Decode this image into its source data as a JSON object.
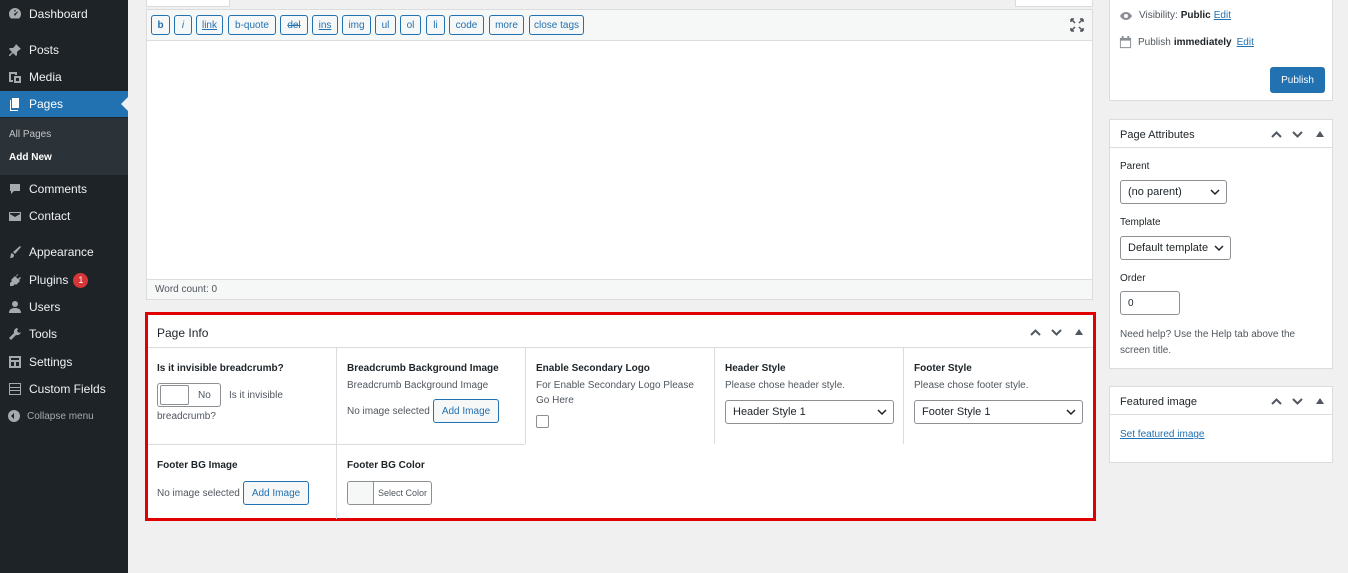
{
  "sidebar": {
    "items": [
      {
        "label": "Dashboard",
        "icon": "dashboard-icon"
      },
      {
        "label": "Posts",
        "icon": "pin-icon"
      },
      {
        "label": "Media",
        "icon": "media-icon"
      },
      {
        "label": "Pages",
        "icon": "pages-icon"
      },
      {
        "label": "Comments",
        "icon": "comment-icon"
      },
      {
        "label": "Contact",
        "icon": "mail-icon"
      },
      {
        "label": "Appearance",
        "icon": "brush-icon"
      },
      {
        "label": "Plugins",
        "icon": "plug-icon"
      },
      {
        "label": "Users",
        "icon": "user-icon"
      },
      {
        "label": "Tools",
        "icon": "wrench-icon"
      },
      {
        "label": "Settings",
        "icon": "settings-icon"
      },
      {
        "label": "Custom Fields",
        "icon": "grid-icon"
      }
    ],
    "submenu": [
      "All Pages",
      "Add New"
    ],
    "plugins_badge": "1",
    "collapse_label": "Collapse menu"
  },
  "editor": {
    "toolbar": [
      "b",
      "i",
      "link",
      "b-quote",
      "del",
      "ins",
      "img",
      "ul",
      "ol",
      "li",
      "code",
      "more",
      "close tags"
    ],
    "word_count": "Word count: 0"
  },
  "page_info": {
    "title": "Page Info",
    "invisible_breadcrumb": {
      "label": "Is it invisible breadcrumb?",
      "toggle": "No",
      "desc_1": "Is it invisible",
      "desc_2": "breadcrumb?"
    },
    "breadcrumb_bg": {
      "label": "Breadcrumb Background Image",
      "desc": "Breadcrumb Background Image",
      "status": "No image selected",
      "button": "Add Image"
    },
    "secondary_logo": {
      "label": "Enable Secondary Logo",
      "desc_1": "For Enable Secondary Logo Please",
      "desc_2": "Go Here"
    },
    "header_style": {
      "label": "Header Style",
      "desc": "Please chose header style.",
      "value": "Header Style 1"
    },
    "footer_style": {
      "label": "Footer Style",
      "desc": "Please chose footer style.",
      "value": "Footer Style 1"
    },
    "footer_bg_image": {
      "label": "Footer BG Image",
      "status": "No image selected",
      "button": "Add Image"
    },
    "footer_bg_color": {
      "label": "Footer BG Color",
      "button": "Select Color"
    }
  },
  "publish": {
    "visibility_label": "Visibility:",
    "visibility_value": "Public",
    "publish_label": "Publish",
    "publish_value": "immediately",
    "edit": "Edit",
    "button": "Publish"
  },
  "page_attributes": {
    "title": "Page Attributes",
    "parent_label": "Parent",
    "parent_value": "(no parent)",
    "template_label": "Template",
    "template_value": "Default template",
    "order_label": "Order",
    "order_value": "0",
    "help": "Need help? Use the Help tab above the screen title."
  },
  "featured_image": {
    "title": "Featured image",
    "link": "Set featured image"
  },
  "colors": {
    "accent": "#2271b1",
    "highlight": "#e00000",
    "sidebar": "#1d2327"
  }
}
